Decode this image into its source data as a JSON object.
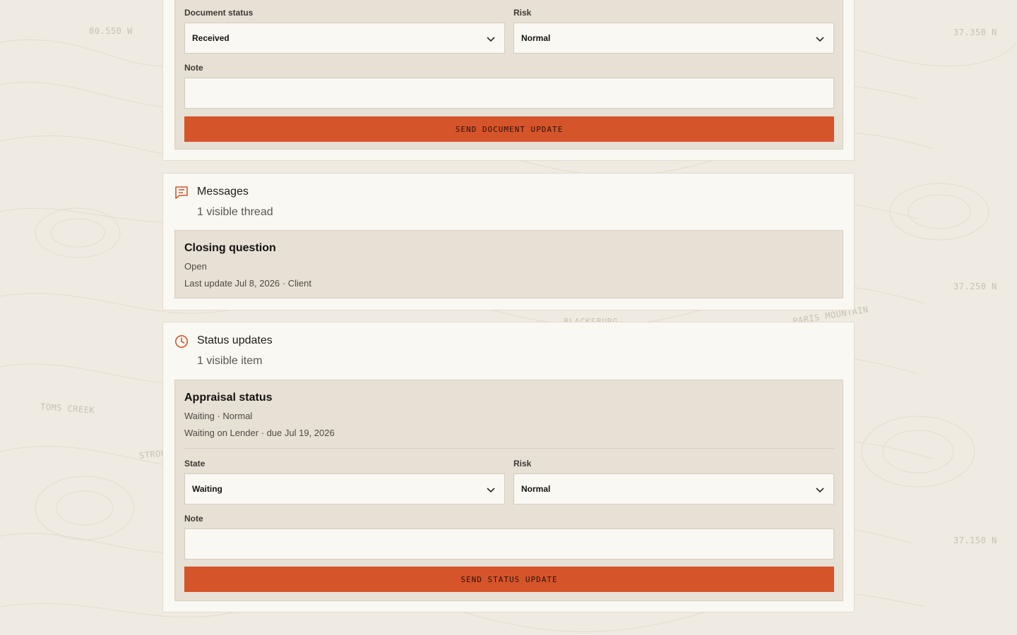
{
  "map": {
    "labels": [
      "80.550 W",
      "37.350 N",
      "37.250 N",
      "37.150 N",
      "BLACKSBURG",
      "PARIS MOUNTAIN",
      "TOMS CREEK",
      "STROU"
    ]
  },
  "document_form": {
    "status_label": "Document status",
    "status_value": "Received",
    "risk_label": "Risk",
    "risk_value": "Normal",
    "note_label": "Note",
    "note_value": "",
    "submit_label": "SEND DOCUMENT UPDATE"
  },
  "messages": {
    "title": "Messages",
    "subtitle": "1 visible thread",
    "threads": [
      {
        "title": "Closing question",
        "state": "Open",
        "meta": "Last update Jul 8, 2026 · Client"
      }
    ]
  },
  "status_updates": {
    "title": "Status updates",
    "subtitle": "1 visible item",
    "items": [
      {
        "title": "Appraisal status",
        "state_line": "Waiting · Normal",
        "meta": "Waiting on Lender · due Jul 19, 2026",
        "state_label": "State",
        "state_value": "Waiting",
        "risk_label": "Risk",
        "risk_value": "Normal",
        "note_label": "Note",
        "note_value": "",
        "submit_label": "SEND STATUS UPDATE"
      }
    ]
  },
  "colors": {
    "accent": "#d6542a",
    "background": "#efebe2",
    "card": "#faf8f3",
    "panel": "#e6e0d5"
  }
}
